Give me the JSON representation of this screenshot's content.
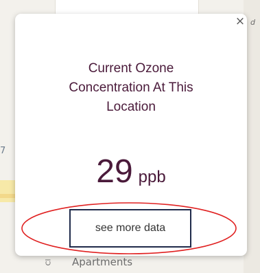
{
  "map": {
    "bottom_label": "Apartments",
    "bottom_icon": "Cl",
    "right_label": "d",
    "left_mark": "7"
  },
  "popup": {
    "close_label": "×",
    "title_line1": "Current Ozone",
    "title_line2": "Concentration At This",
    "title_line3": "Location",
    "value": "29",
    "unit": "ppb",
    "button_label": "see more data"
  },
  "colors": {
    "title": "#4a1a3a",
    "highlight_ring": "#e02020",
    "button_border": "#1f2a4a"
  }
}
